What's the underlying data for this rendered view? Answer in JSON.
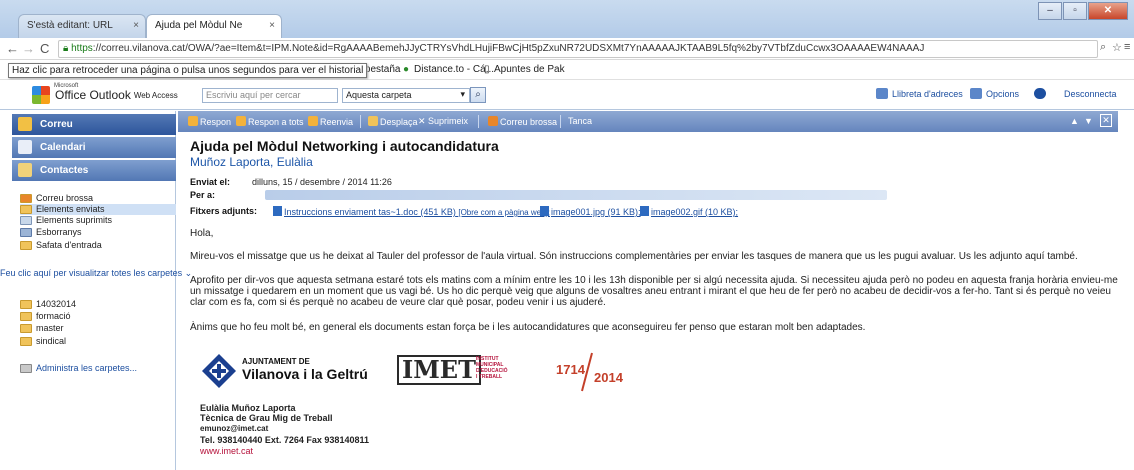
{
  "browser": {
    "tab_inactive": "S'està editant: URL",
    "tab_active": "Ajuda pel Mòdul Ne",
    "tab_close": "×",
    "url_https": "https",
    "url_rest": "://correu.vilanova.cat/OWA/?ae=Item&t=IPM.Note&id=RgAAAABemehJJyCTRYsVhdLHujiFBwCjHt5pZxuNR72UDSXMt7YnAAAAAJKTAAB9L5fq%2by7VTbfZduCcwx3OAAAAEW4NAAAJ",
    "tooltip": "Haz clic para retroceder una página o pulsa unos segundos para ver el historial",
    "bookmarks": [
      "eva pestaña",
      "Distance.to - Cá...",
      "Apuntes de Pak"
    ]
  },
  "owa": {
    "logo_ms": "Microsoft",
    "logo_title": "Office Outlook",
    "logo_sub": "Web Access",
    "search_placeholder": "Escriviu aquí per cercar",
    "scope": "Aquesta carpeta",
    "addressbook": "Llibreta d'adreces",
    "options": "Opcions",
    "logout": "Desconnecta"
  },
  "sidebar": {
    "nav": [
      "Correu",
      "Calendari",
      "Contactes"
    ],
    "folders": [
      "Correu brossa",
      "Elements enviats",
      "Elements suprimits",
      "Esborranys",
      "Safata d'entrada"
    ],
    "show_all": "Feu clic aquí per visualitzar totes les carpetes",
    "custom_folders": [
      "14032014",
      "formació",
      "master",
      "sindical"
    ],
    "manage": "Administra les carpetes..."
  },
  "toolbar": {
    "reply": "Respon",
    "reply_all": "Respon a tots",
    "forward": "Reenvia",
    "move": "Desplaça",
    "delete": "Suprimeix",
    "junk": "Correu brossa",
    "close": "Tanca"
  },
  "message": {
    "subject": "Ajuda pel Mòdul Networking i autocandidatura",
    "from": "Muñoz Laporta, Eulàlia",
    "sent_label": "Enviat el:",
    "sent_value": "dilluns, 15 / desembre / 2014 11:26",
    "to_label": "Per a:",
    "attach_label": "Fitxers adjunts:",
    "attachments": [
      {
        "name": "Instruccions enviament tas~1.doc (451 KB)",
        "extra": "[Obre com a pàgina web];"
      },
      {
        "name": "image001.jpg (91 KB);",
        "extra": ""
      },
      {
        "name": "image002.gif (10 KB);",
        "extra": ""
      }
    ],
    "greeting": "Hola,",
    "p1": "Mireu-vos el missatge que us he deixat al Tauler del professor de l'aula virtual. Són instruccions complementàries per enviar les tasques de manera que us les pugui avaluar. Us les adjunto aquí també.",
    "p2a": "Aprofito per dir-vos que aquesta setmana estaré tots els matins com a mínim entre les 10 i les 13h disponible per si algú necessita ajuda. Si necessiteu ajuda però no podeu en aquesta franja horària envieu-me",
    "p2b": "un missatge i quedarem en un moment que us vagi bé. Us ho dic perquè veig que alguns de vosaltres aneu entrant i mirant el que heu de fer però no acabeu de decidir-vos a fer-ho. Tant si és perquè no veieu",
    "p2c": "clar com es fa, com si és perquè no acabeu de veure clar què posar, podeu venir  i us ajuderé.",
    "p3": "Ànims que ho feu molt bé, en general els documents estan força be i les autocandidatures que aconseguireu fer penso que estaran molt ben adaptades."
  },
  "signature": {
    "ajunt_1": "AJUNTAMENT DE",
    "ajunt_2": "Vilanova i la Geltrú",
    "imet": "IMET",
    "imet_sub": [
      "INSTITUT",
      "MUNICIPAL",
      "D'EDUCACIÓ",
      "I TREBALL"
    ],
    "y1": "1714",
    "y2": "2014",
    "name": "Eulàlia Muñoz Laporta",
    "role": "Tècnica de Grau Mig de Treball",
    "email": "emunoz@imet.cat",
    "phone": "Tel. 938140440  Ext. 7264  Fax 938140811",
    "web": "www.imet.cat"
  }
}
